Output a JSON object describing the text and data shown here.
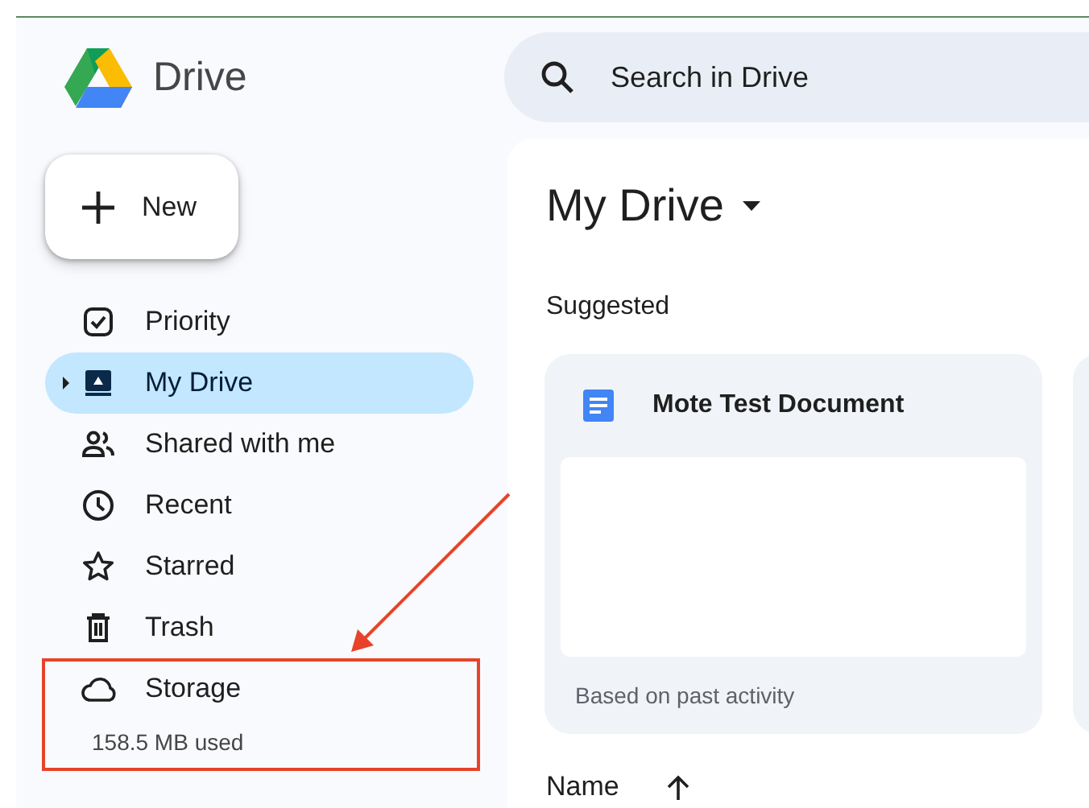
{
  "app": {
    "name": "Drive"
  },
  "search": {
    "placeholder": "Search in Drive"
  },
  "new_button": {
    "label": "New"
  },
  "sidebar": {
    "items": [
      {
        "label": "Priority",
        "kind": "priority",
        "selected": false
      },
      {
        "label": "My Drive",
        "kind": "drive",
        "selected": true,
        "expanded": false
      },
      {
        "label": "Shared with me",
        "kind": "shared",
        "selected": false
      },
      {
        "label": "Recent",
        "kind": "recent",
        "selected": false
      },
      {
        "label": "Starred",
        "kind": "starred",
        "selected": false
      },
      {
        "label": "Trash",
        "kind": "trash",
        "selected": false
      }
    ]
  },
  "storage": {
    "label": "Storage",
    "usage": "158.5 MB used"
  },
  "main": {
    "title": "My Drive",
    "section": "Suggested",
    "cards": [
      {
        "title": "Mote Test Document",
        "reason": "Based on past activity"
      }
    ],
    "list_header": {
      "column_1": "Name"
    }
  }
}
